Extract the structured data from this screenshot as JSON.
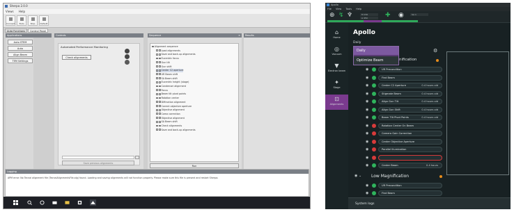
{
  "left_app": {
    "window_title": "Sherpa 2.0.0",
    "menu": [
      "Views",
      "Help"
    ],
    "toolbar_buttons": [
      "Connect",
      "Tools",
      "Stop",
      "Default"
    ],
    "tabs": [
      "Auto Functions",
      "Control Panel"
    ],
    "panels": {
      "left_header": "Applications",
      "control_header": "Controls",
      "sequence_header": "Sequence",
      "results_header": "Results",
      "log_header": "Logging"
    },
    "nav_buttons": [
      "Auto STEM",
      "Auto",
      "Align Beam",
      "TEM Settings"
    ],
    "control": {
      "label": "Automated Performance Monitoring",
      "check_button": "Check alignments",
      "save_button": "Save previous alignments"
    },
    "sequence_items": [
      "Alignment sequence",
      "Load alignments",
      "Save and back-up alignments",
      "Eucentric focus",
      "Gun tilt",
      "Gun shift",
      "Center C2 aperture",
      "UR Beam shift",
      "SA Beam shift",
      "Eucentric height (stage)",
      "Condenser alignment",
      "Focus",
      "Beam tilt pivot points",
      "Rotation center",
      "Diffraction alignment",
      "Correct objective aperture",
      "Objective alignment",
      "Coma correction",
      "Objective alignment",
      "SA Beam shift",
      "Check alignments",
      "Save and back-up alignments"
    ],
    "run_button": "Run",
    "log_text": "APM error: No Tecnai alignment file (TecnaiAlignmentsFile.alg) found. Loading and saving alignments will not function properly. Please make sure this file is present and restart Sherpa."
  },
  "right_app": {
    "window_title": "Apollo",
    "menu": [
      "File",
      "View",
      "Tools",
      "Help"
    ],
    "toolbar_fields": [
      "M 150",
      "A 450",
      "SA 1"
    ],
    "sidebar": [
      {
        "label": "Home",
        "icon": "home-icon"
      },
      {
        "label": "Vacuum",
        "icon": "vacuum-icon"
      },
      {
        "label": "Electron beam",
        "icon": "beam-icon"
      },
      {
        "label": "Stage",
        "icon": "stage-icon"
      },
      {
        "label": "Alignments",
        "icon": "alignments-icon"
      }
    ],
    "title": "Apollo",
    "subtitle": "Daily",
    "dropdown_options": [
      "Daily",
      "Optimize Beam"
    ],
    "section_header": "nification",
    "rows": [
      {
        "label": "UR Precondition",
        "status": "green",
        "value": ""
      },
      {
        "label": "Find Beam",
        "status": "green",
        "value": ""
      },
      {
        "label": "Center C2 Aperture",
        "status": "green",
        "value": "0.4 hours old"
      },
      {
        "label": "Stigmate Beam",
        "status": "green",
        "value": "0.4 hours old"
      },
      {
        "label": "Align Gun Tilt",
        "status": "green",
        "value": "0.4 hours old"
      },
      {
        "label": "Align Gun Shift",
        "status": "green",
        "value": "0.4 hours old"
      },
      {
        "label": "Beam Tilt Pivot Points",
        "status": "green",
        "value": "0.4 hours old"
      },
      {
        "label": "Rotation Center On Beam",
        "status": "red",
        "value": ""
      },
      {
        "label": "Camera Gain Correction",
        "status": "red",
        "value": ""
      },
      {
        "label": "Center Objective Aperture",
        "status": "red",
        "value": ""
      },
      {
        "label": "Parallel Illumination",
        "status": "red",
        "value": ""
      },
      {
        "label": "",
        "status": "red",
        "value": ""
      },
      {
        "label": "Center Beam",
        "status": "green",
        "value": "0.4 hours"
      }
    ],
    "section2": "Low Magnification",
    "rows2": [
      {
        "label": "UR Precondition",
        "status": "green"
      },
      {
        "label": "Find Beam",
        "status": "green"
      }
    ],
    "system_logs": "System logs"
  }
}
